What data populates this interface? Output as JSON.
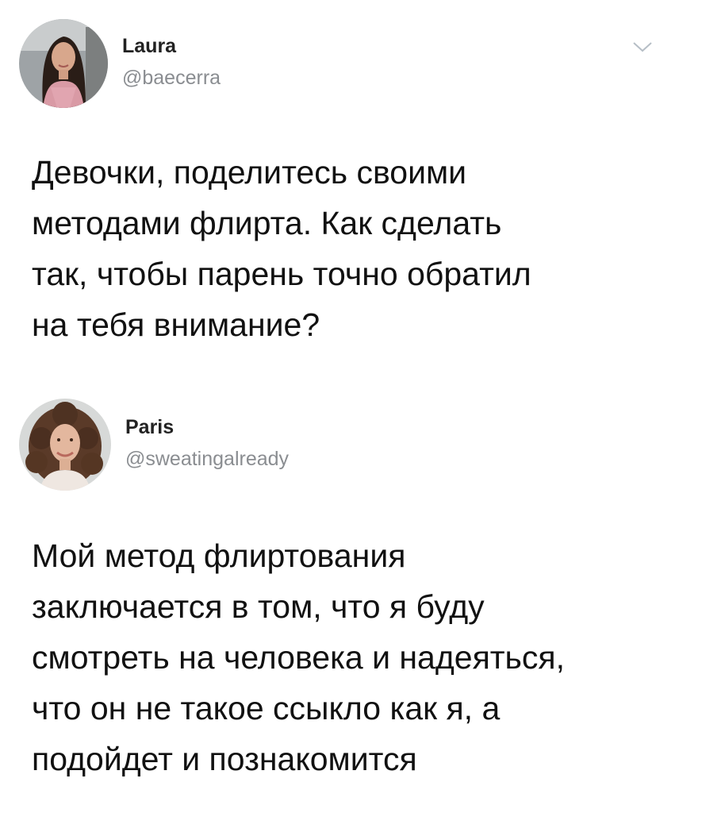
{
  "tweets": [
    {
      "author": {
        "name": "Laura",
        "handle": "@baecerra",
        "avatar_icon": "avatar-photo-woman-dark-hair"
      },
      "menu_icon": "chevron-down-icon",
      "lines": [
        "Девочки, поделитесь своими",
        "методами флирта. Как сделать",
        "так, чтобы парень точно обратил",
        "на тебя внимание?"
      ]
    },
    {
      "author": {
        "name": "Paris",
        "handle": "@sweatingalready",
        "avatar_icon": "avatar-photo-woman-curly-hair"
      },
      "lines": [
        "Мой метод флиртования",
        "заключается в том, что я буду",
        "смотреть на человека и надеяться,",
        "что он не такое ссыкло как я, а",
        "подойдет и познакомится"
      ]
    }
  ],
  "colors": {
    "text": "#111111",
    "handle": "#8a8d91",
    "chevron": "#b6bec6"
  }
}
